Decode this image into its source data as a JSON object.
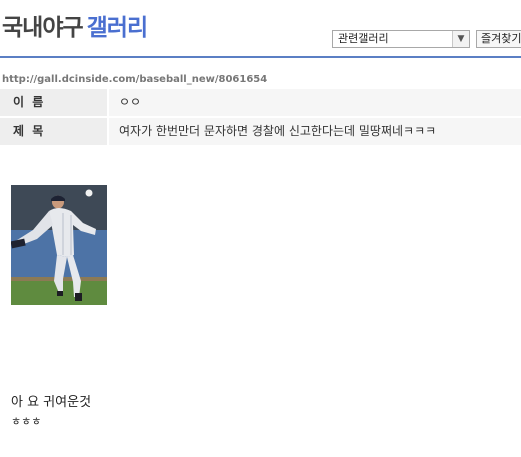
{
  "header": {
    "logo_part1": "국내야구",
    "logo_part2": "갤러리",
    "gallery_select_value": "관련갤러리",
    "favorites_label": "즐겨찾기"
  },
  "post": {
    "url": "http://gall.dcinside.com/baseball_new/8061654",
    "name_label": "이 름",
    "name_value": "ㅇㅇ",
    "title_label": "제 목",
    "title_value": "여자가 한번만더 문자하면 경찰에 신고한다는데 밀땅쩌네ㅋㅋㅋ",
    "body_line1": "아 요 귀여운것",
    "body_line2": "ㅎㅎㅎ"
  },
  "icons": {
    "dropdown": "chevron-down-icon"
  },
  "colors": {
    "accent_blue": "#4a6fd0",
    "header_rule": "#5b7fc4"
  }
}
